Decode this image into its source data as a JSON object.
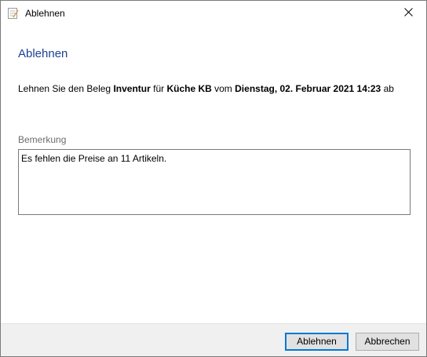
{
  "window": {
    "title": "Ablehnen",
    "icon": "document-stamp-icon",
    "close_glyph": "✕"
  },
  "dialog": {
    "heading": "Ablehnen",
    "message": {
      "part1": "Lehnen Sie den Beleg ",
      "document_type": "Inventur",
      "part2": " für ",
      "location": "Küche KB",
      "part3": " vom ",
      "date": "Dienstag, 02. Februar 2021 14:23",
      "part4": " ab"
    },
    "remark": {
      "label": "Bemerkung",
      "value": "Es fehlen die Preise an 11 Artikeln."
    }
  },
  "buttons": {
    "ok_label": "Ablehnen",
    "cancel_label": "Abbrechen"
  },
  "colors": {
    "heading": "#1c3f95",
    "footer_background": "#f0f0f0",
    "default_button_border": "#0078d7"
  }
}
